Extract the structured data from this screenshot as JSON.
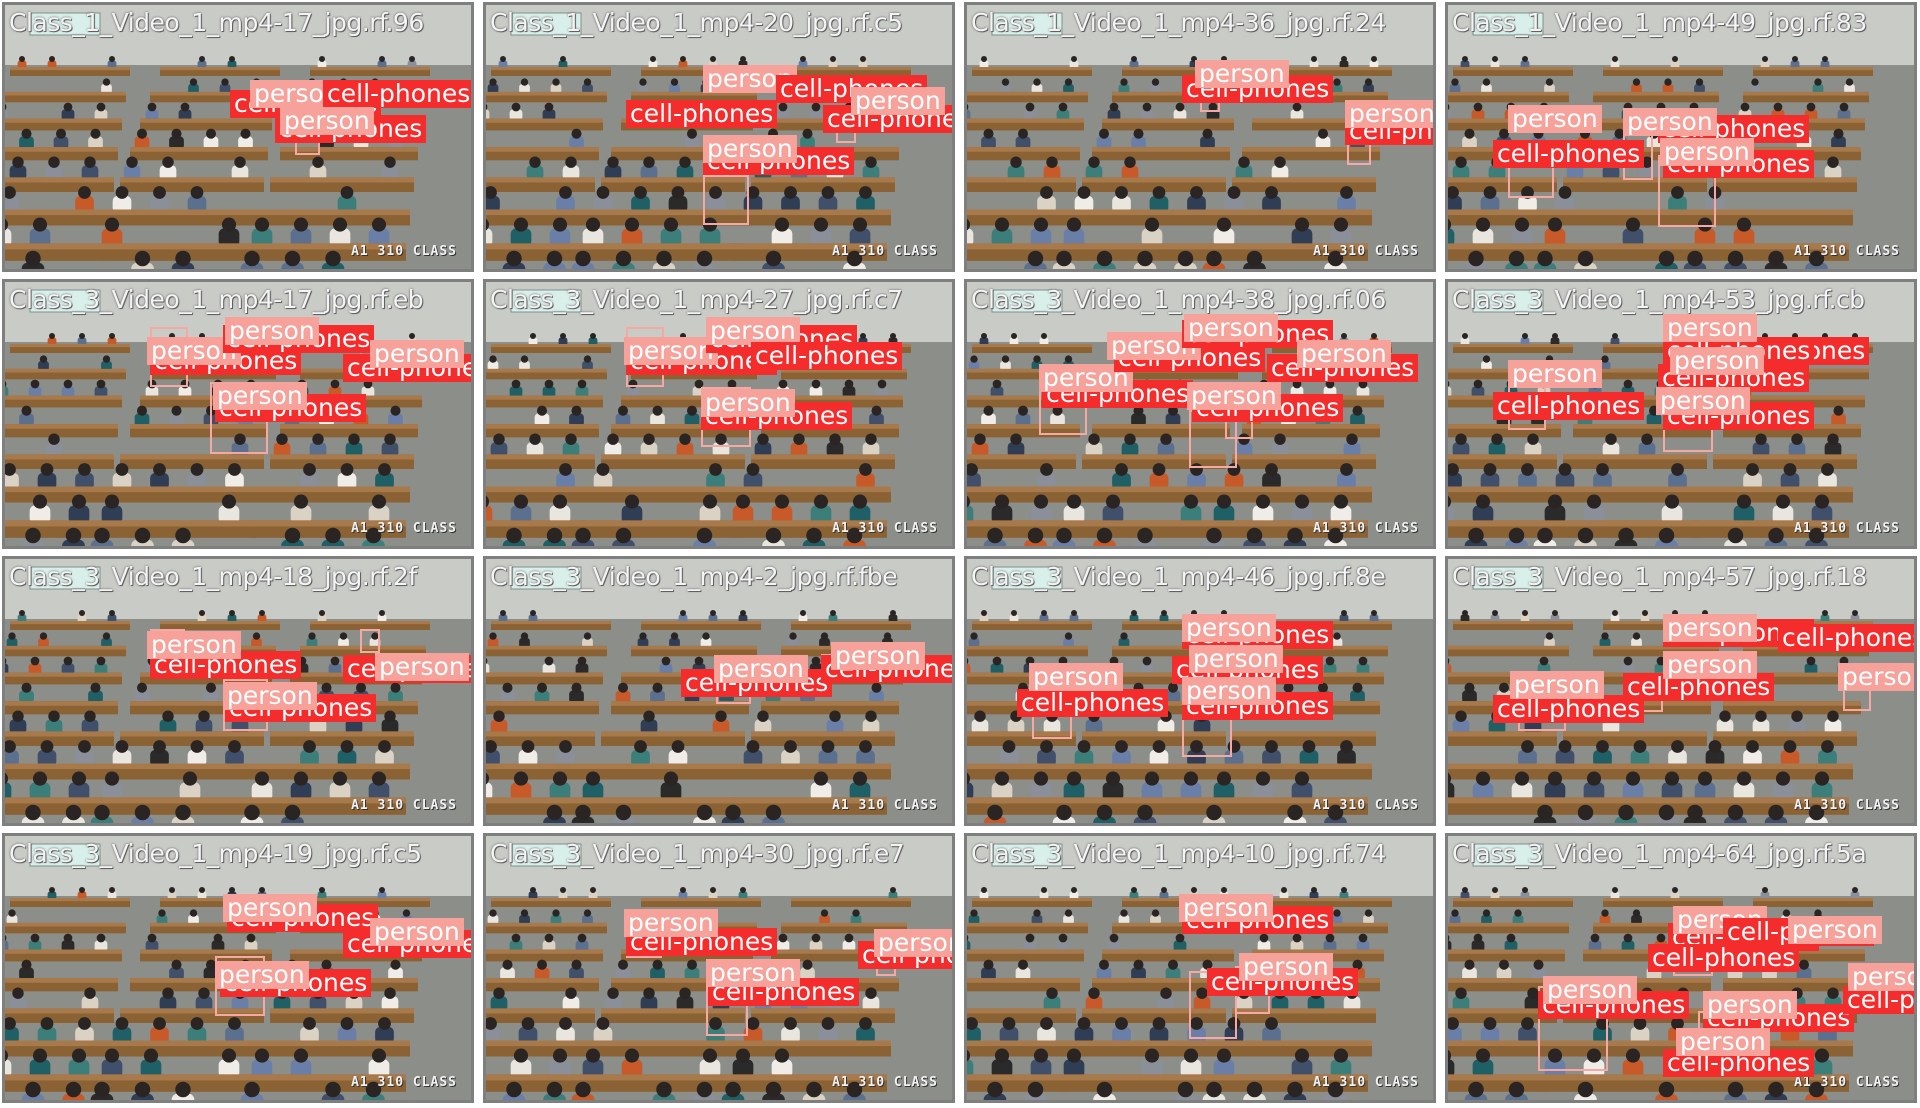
{
  "classes": {
    "person": {
      "name": "person",
      "color": "#f6a19a"
    },
    "phone": {
      "name": "cell-phones",
      "color": "#f42c2c"
    }
  },
  "tiles": [
    {
      "filename": "Class_1_Video_1_mp4-17_jpg.rf.96",
      "stamp": "A1 310 CLASS"
    },
    {
      "filename": "Class_1_Video_1_mp4-20_jpg.rf.c5",
      "stamp": "A1 310 CLASS"
    },
    {
      "filename": "Class_1_Video_1_mp4-36_jpg.rf.24",
      "stamp": "A1 310 CLASS"
    },
    {
      "filename": "Class_1_Video_1_mp4-49_jpg.rf.83",
      "stamp": "A1 310 CLASS"
    },
    {
      "filename": "Class_3_Video_1_mp4-17_jpg.rf.eb",
      "stamp": "A1 310 CLASS"
    },
    {
      "filename": "Class_3_Video_1_mp4-27_jpg.rf.c7",
      "stamp": "A1 310 CLASS"
    },
    {
      "filename": "Class_3_Video_1_mp4-38_jpg.rf.06",
      "stamp": "A1 310 CLASS"
    },
    {
      "filename": "Class_3_Video_1_mp4-53_jpg.rf.cb",
      "stamp": "A1 310 CLASS"
    },
    {
      "filename": "Class_3_Video_1_mp4-18_jpg.rf.2f",
      "stamp": "A1 310 CLASS"
    },
    {
      "filename": "Class_3_Video_1_mp4-2_jpg.rf.fbe",
      "stamp": "A1 310 CLASS"
    },
    {
      "filename": "Class_3_Video_1_mp4-46_jpg.rf.8e",
      "stamp": "A1 310 CLASS"
    },
    {
      "filename": "Class_3_Video_1_mp4-57_jpg.rf.18",
      "stamp": "A1 310 CLASS"
    },
    {
      "filename": "Class_3_Video_1_mp4-19_jpg.rf.c5",
      "stamp": "A1 310 CLASS"
    },
    {
      "filename": "Class_3_Video_1_mp4-30_jpg.rf.e7",
      "stamp": "A1 310 CLASS"
    },
    {
      "filename": "Class_3_Video_1_mp4-10_jpg.rf.74",
      "stamp": "A1 310 CLASS"
    },
    {
      "filename": "Class_3_Video_1_mp4-64_jpg.rf.5a",
      "stamp": "A1 310 CLASS"
    }
  ]
}
